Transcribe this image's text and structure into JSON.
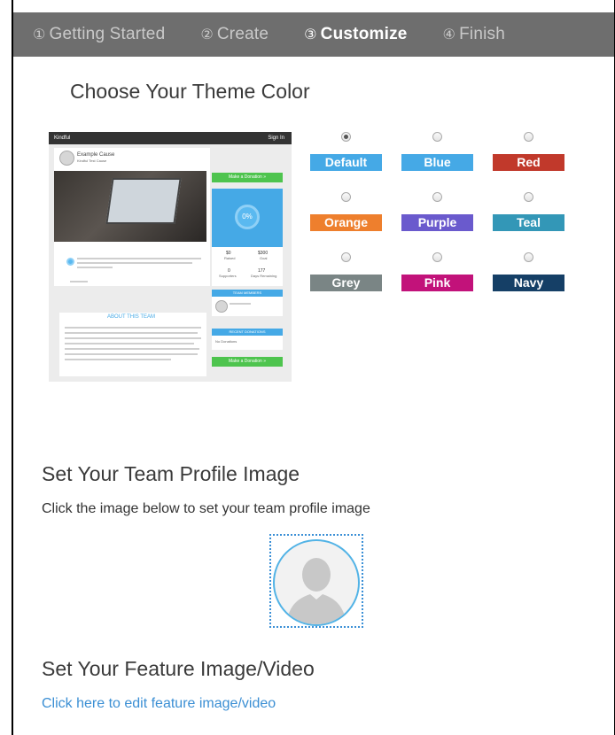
{
  "wizard": {
    "steps": [
      {
        "num": "①",
        "label": "Getting Started"
      },
      {
        "num": "②",
        "label": "Create"
      },
      {
        "num": "③",
        "label": "Customize"
      },
      {
        "num": "④",
        "label": "Finish"
      }
    ],
    "active_index": 2
  },
  "theme": {
    "heading": "Choose Your Theme Color",
    "colors": [
      {
        "label": "Default",
        "hex": "#45a9e6",
        "selected": true
      },
      {
        "label": "Blue",
        "hex": "#45a9e6",
        "selected": false
      },
      {
        "label": "Red",
        "hex": "#c1392b",
        "selected": false
      },
      {
        "label": "Orange",
        "hex": "#ee7f2d",
        "selected": false
      },
      {
        "label": "Purple",
        "hex": "#6a5acd",
        "selected": false
      },
      {
        "label": "Teal",
        "hex": "#3397b7",
        "selected": false
      },
      {
        "label": "Grey",
        "hex": "#7a8585",
        "selected": false
      },
      {
        "label": "Pink",
        "hex": "#c2127a",
        "selected": false
      },
      {
        "label": "Navy",
        "hex": "#153f66",
        "selected": false
      }
    ]
  },
  "preview": {
    "logo": "Kindful",
    "signin": "Sign In",
    "cause_title": "Example Cause",
    "cause_sub": "Kindful Test Cause",
    "donate_label": "Make a Donation »",
    "progress_label": "0%",
    "raised_value": "$0",
    "raised_label": "Raised",
    "goal_value": "$300",
    "goal_label": "Goal",
    "supporters_value": "0",
    "supporters_label": "Supporters",
    "days_value": "177",
    "days_label": "Days Remaining",
    "team_members": "TEAM MEMBERS",
    "about_team": "ABOUT THIS TEAM",
    "recent_donations": "RECENT DONATIONS",
    "no_donations": "No Donations"
  },
  "profile": {
    "heading": "Set Your Team Profile Image",
    "instruction": "Click the image below to set your team profile image"
  },
  "feature": {
    "heading": "Set Your Feature Image/Video",
    "link": "Click here to edit feature image/video"
  }
}
